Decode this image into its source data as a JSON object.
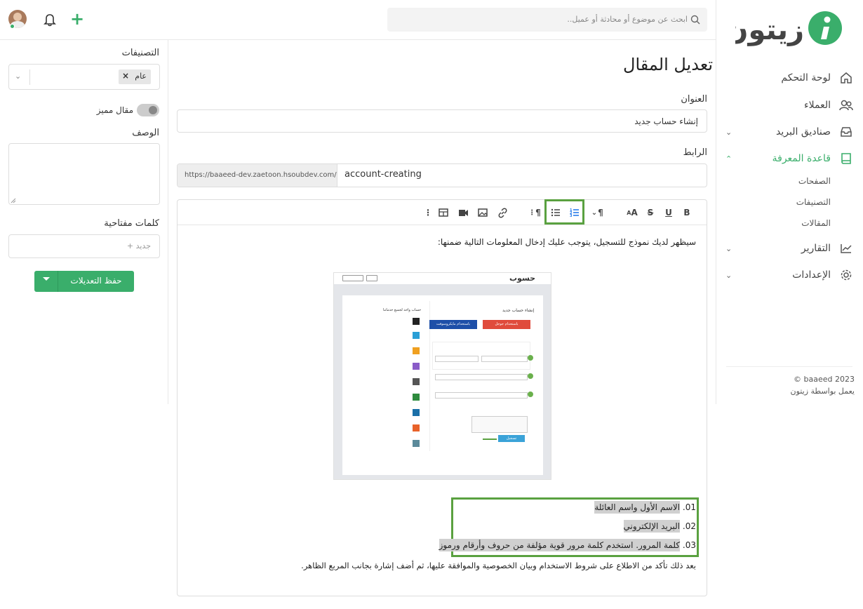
{
  "brand": {
    "name": "زيتون",
    "accent": "#3aae6b"
  },
  "nav": {
    "items": [
      {
        "label": "لوحة التحكم",
        "icon": "home-icon"
      },
      {
        "label": "العملاء",
        "icon": "users-icon"
      },
      {
        "label": "صناديق البريد",
        "icon": "inbox-icon"
      },
      {
        "label": "قاعدة المعرفة",
        "icon": "book-icon"
      },
      {
        "label": "التقارير",
        "icon": "chart-icon"
      },
      {
        "label": "الإعدادات",
        "icon": "gear-icon"
      }
    ],
    "sub": [
      "الصفحات",
      "التصنيفات",
      "المقالات"
    ],
    "footer": {
      "copyright": "© baaeed 2023",
      "powered": "يعمل بواسطة زيتون"
    }
  },
  "search": {
    "placeholder": "ابحث عن موضوع أو محادثة أو عميل.."
  },
  "page": {
    "title": "تعديل المقال"
  },
  "form": {
    "title_label": "العنوان",
    "title_value": "إنشاء حساب جديد",
    "link_label": "الرابط",
    "link_prefix": "https://baaeed-dev.zaetoon.hsoubdev.com/",
    "link_slug": "account-creating"
  },
  "side": {
    "categories_label": "التصنيفات",
    "category_tag": "عام",
    "tag_remove": "×",
    "featured_label": "مقال مميز",
    "desc_label": "الوصف",
    "keywords_label": "كلمات مفتاحية",
    "keywords_placeholder": "+ جديد",
    "save_label": "حفظ التعديلات"
  },
  "toolbar": {
    "bold": "B",
    "underline": "U",
    "strike": "S",
    "font": "A",
    "para": "¶",
    "more": "⋮"
  },
  "content": {
    "intro": "سيظهر لديك نموذج للتسجيل، يتوجب عليك إدخال المعلومات التالية ضمنها:",
    "list": [
      {
        "num": "01.",
        "text": "الاسم الأول واسم العائلة"
      },
      {
        "num": "02.",
        "text": "البريد الإلكتروني"
      },
      {
        "num": "03.",
        "text": "كلمة المرور. استخدم كلمة مرور قوية مؤلفة من حروف وأرقام ورموز"
      }
    ],
    "outro": "بعد ذلك تأكد من الاطلاع على شروط الاستخدام وبيان الخصوصية والموافقة عليها، ثم أضف إشارة بجانب المربع الظاهر.",
    "image": {
      "logo": "حسوب",
      "form_title": "إنشاء حساب جديد",
      "google": "باستخدام جوجل",
      "microsoft": "باستخدام مايكروسوفت",
      "side_title": "حساب واحد لجميع خدماتنا",
      "submit": "تسجيل"
    }
  }
}
